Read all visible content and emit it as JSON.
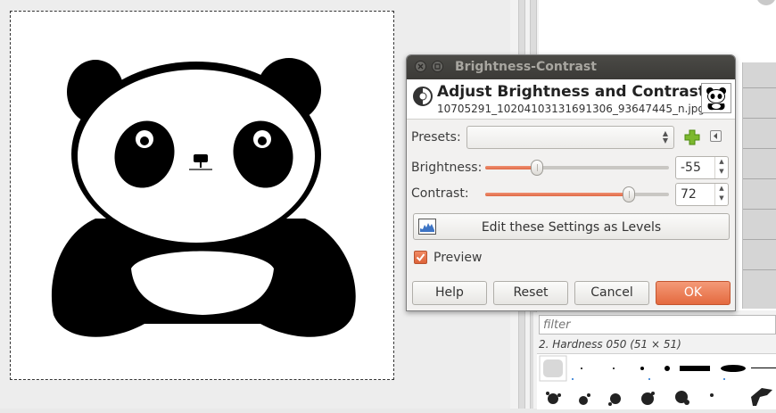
{
  "dialog": {
    "window_title": "Brightness-Contrast",
    "header_title": "Adjust Brightness and Contrast",
    "header_filename": "10705291_10204103131691306_93647445_n.jpg...",
    "presets_label": "Presets:",
    "presets_value": "",
    "brightness": {
      "label": "Brightness:",
      "value": "-55",
      "min": -127,
      "max": 127
    },
    "contrast": {
      "label": "Contrast:",
      "value": "72",
      "min": -127,
      "max": 127
    },
    "levels_button": "Edit these Settings as Levels",
    "preview": {
      "label": "Preview",
      "checked": true
    },
    "buttons": {
      "help": "Help",
      "reset": "Reset",
      "cancel": "Cancel",
      "ok": "OK"
    },
    "accent_color": "#e4693f"
  },
  "dock": {
    "filter_placeholder": "filter",
    "brush_name": "2. Hardness 050 (51 × 51)"
  },
  "canvas": {
    "image_subject": "panda illustration"
  }
}
